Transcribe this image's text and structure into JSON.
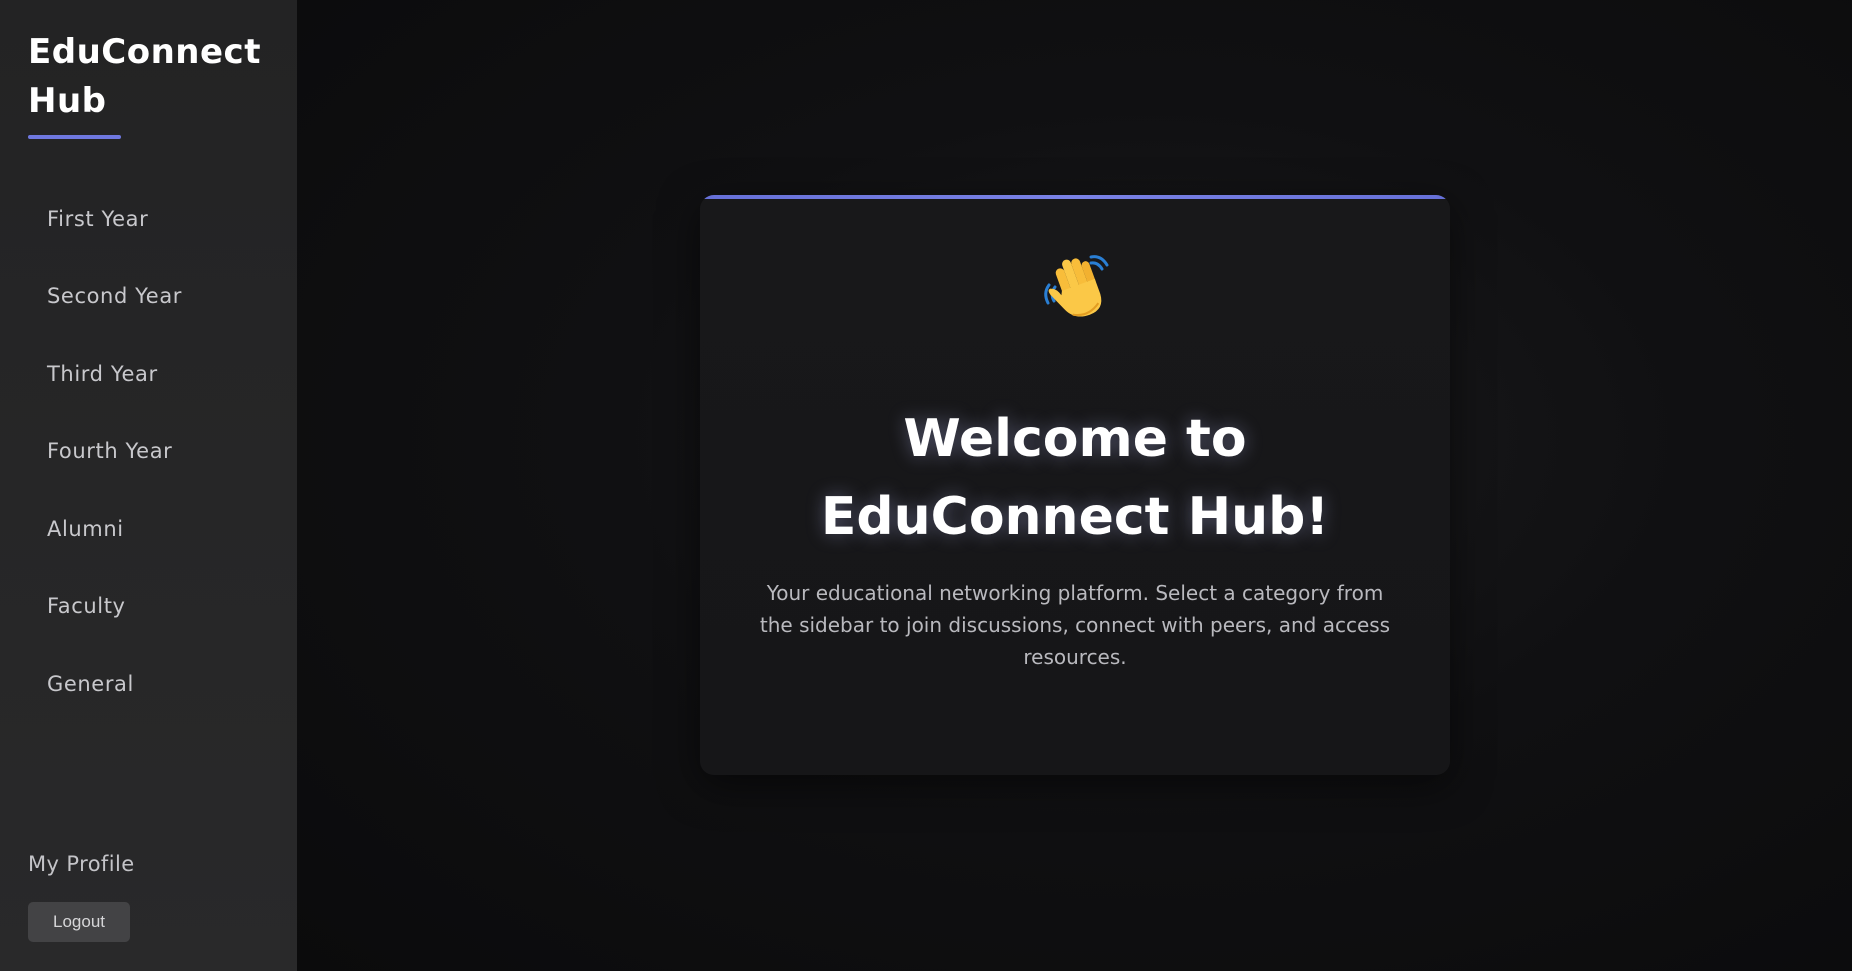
{
  "sidebar": {
    "brand": "EduConnect Hub",
    "items": [
      {
        "label": "First Year"
      },
      {
        "label": "Second Year"
      },
      {
        "label": "Third Year"
      },
      {
        "label": "Fourth Year"
      },
      {
        "label": "Alumni"
      },
      {
        "label": "Faculty"
      },
      {
        "label": "General"
      }
    ],
    "profile_label": "My Profile",
    "logout_label": "Logout"
  },
  "main": {
    "icon": "waving-hand-icon",
    "title": "Welcome to EduConnect Hub!",
    "description": "Your educational networking platform. Select a category from the sidebar to join discussions, connect with peers, and access resources."
  },
  "colors": {
    "accent": "#6f78e0",
    "sidebar_bg": "#262627",
    "main_bg": "#0d0d0f",
    "card_bg": "#18181a"
  }
}
